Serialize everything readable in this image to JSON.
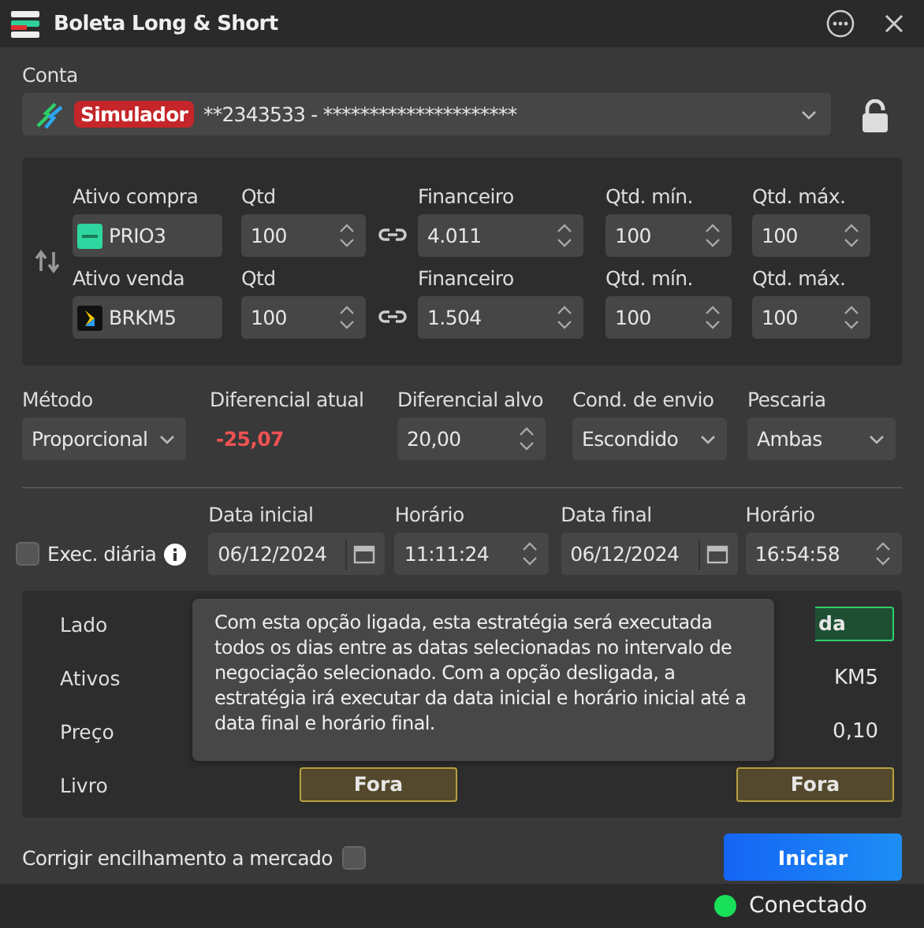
{
  "window": {
    "title": "Boleta Long & Short"
  },
  "account": {
    "label": "Conta",
    "badge": "Simulador",
    "value": "**2343533 - *********************",
    "locked": false
  },
  "legs": [
    {
      "asset_label": "Ativo compra",
      "asset": "PRIO3",
      "qty_label": "Qtd",
      "qty": "100",
      "fin_label": "Financeiro",
      "fin": "4.011",
      "min_label": "Qtd. mín.",
      "min": "100",
      "max_label": "Qtd. máx.",
      "max": "100"
    },
    {
      "asset_label": "Ativo venda",
      "asset": "BRKM5",
      "qty_label": "Qtd",
      "qty": "100",
      "fin_label": "Financeiro",
      "fin": "1.504",
      "min_label": "Qtd. mín.",
      "min": "100",
      "max_label": "Qtd. máx.",
      "max": "100"
    }
  ],
  "settings": [
    {
      "kind": "select",
      "label": "Método",
      "value": "Proporcional"
    },
    {
      "kind": "readout",
      "label": "Diferencial atual",
      "value": "-25,07",
      "color": "#f05252"
    },
    {
      "kind": "spin",
      "label": "Diferencial alvo",
      "value": "20,00"
    },
    {
      "kind": "select",
      "label": "Cond. de envio",
      "value": "Escondido"
    },
    {
      "kind": "select",
      "label": "Pescaria",
      "value": "Ambas"
    }
  ],
  "schedule": {
    "daily_label": "Exec. diária",
    "daily_checked": false,
    "fields": [
      {
        "kind": "date",
        "label": "Data inicial",
        "value": "06/12/2024"
      },
      {
        "kind": "time",
        "label": "Horário",
        "value": "11:11:24"
      },
      {
        "kind": "date",
        "label": "Data final",
        "value": "06/12/2024"
      },
      {
        "kind": "time",
        "label": "Horário",
        "value": "16:54:58"
      }
    ]
  },
  "summary": {
    "rows": [
      {
        "label": "Lado",
        "right": {
          "kind": "side",
          "text": "da"
        }
      },
      {
        "label": "Ativos",
        "right": {
          "kind": "text",
          "text": "KM5"
        }
      },
      {
        "label": "Preço",
        "right": {
          "kind": "text",
          "text": "0,10"
        }
      },
      {
        "label": "Livro",
        "left": {
          "kind": "book",
          "text": "Fora"
        },
        "right": {
          "kind": "book",
          "text": "Fora"
        }
      }
    ]
  },
  "tooltip": "Com esta opção ligada, esta estratégia será executada todos os dias entre as datas selecionadas no intervalo de negociação selecionado. Com a opção desligada, a estratégia irá executar da data inicial e horário inicial até a data final e horário final.",
  "correction": {
    "label": "Corrigir encilhamento a mercado",
    "checked": false
  },
  "start_button": "Iniciar",
  "status_bar": {
    "text": "Conectado",
    "connected": true
  }
}
